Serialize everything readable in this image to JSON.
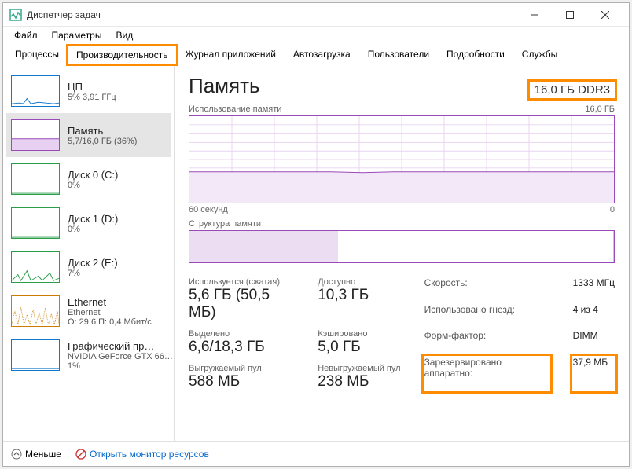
{
  "window": {
    "title": "Диспетчер задач"
  },
  "menu": {
    "file": "Файл",
    "options": "Параметры",
    "view": "Вид"
  },
  "tabs": {
    "processes": "Процессы",
    "performance": "Производительность",
    "app_history": "Журнал приложений",
    "startup": "Автозагрузка",
    "users": "Пользователи",
    "details": "Подробности",
    "services": "Службы"
  },
  "sidebar": {
    "cpu": {
      "title": "ЦП",
      "sub": "5% 3,91 ГГц"
    },
    "memory": {
      "title": "Память",
      "sub": "5,7/16,0 ГБ (36%)"
    },
    "disk0": {
      "title": "Диск 0 (C:)",
      "sub": "0%"
    },
    "disk1": {
      "title": "Диск 1 (D:)",
      "sub": "0%"
    },
    "disk2": {
      "title": "Диск 2 (E:)",
      "sub": "7%"
    },
    "ethernet": {
      "title": "Ethernet",
      "sub": "Ethernet",
      "sub2": "О: 29,6  П: 0,4 Мбит/с"
    },
    "gpu": {
      "title": "Графический пр…",
      "sub": "NVIDIA GeForce GTX 66…",
      "sub2": "1%"
    }
  },
  "main": {
    "title": "Память",
    "capacity": "16,0 ГБ DDR3",
    "chart1_label": "Использование памяти",
    "chart1_max": "16,0 ГБ",
    "chart1_xmin": "60 секунд",
    "chart1_xmax": "0",
    "chart2_label": "Структура памяти"
  },
  "stats": {
    "in_use_label": "Используется (сжатая)",
    "in_use_value": "5,6 ГБ (50,5 МБ)",
    "available_label": "Доступно",
    "available_value": "10,3 ГБ",
    "committed_label": "Выделено",
    "committed_value": "6,6/18,3 ГБ",
    "cached_label": "Кэшировано",
    "cached_value": "5,0 ГБ",
    "paged_label": "Выгружаемый пул",
    "paged_value": "588 МБ",
    "nonpaged_label": "Невыгружаемый пул",
    "nonpaged_value": "238 МБ"
  },
  "right_stats": {
    "speed_label": "Скорость:",
    "speed_value": "1333 МГц",
    "slots_label": "Использовано гнезд:",
    "slots_value": "4 из 4",
    "form_label": "Форм-фактор:",
    "form_value": "DIMM",
    "hw_label": "Зарезервировано аппаратно:",
    "hw_value": "37,9 МБ"
  },
  "footer": {
    "fewer": "Меньше",
    "resmon": "Открыть монитор ресурсов"
  },
  "chart_data": {
    "type": "line",
    "ylim": [
      0,
      16
    ],
    "yunit": "ГБ",
    "x_range_seconds": [
      60,
      0
    ],
    "series": [
      {
        "name": "Использование памяти",
        "values_gb_approx": [
          5.7,
          5.7,
          5.7,
          5.7,
          5.7,
          5.7,
          5.7,
          5.7,
          5.6,
          5.7,
          5.7,
          5.7,
          5.7,
          5.7,
          5.7,
          5.7,
          5.7,
          5.7,
          5.7,
          5.7
        ]
      }
    ],
    "composition_fractions": {
      "in_use": 0.35,
      "modified": 0.015,
      "standby": 0.31,
      "free": 0.325
    }
  }
}
